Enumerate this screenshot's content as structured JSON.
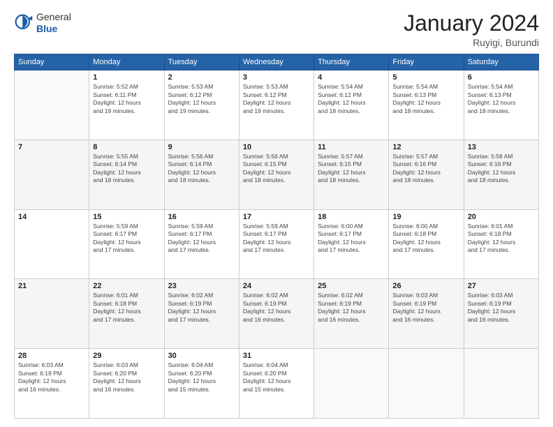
{
  "header": {
    "logo_general": "General",
    "logo_blue": "Blue",
    "title": "January 2024",
    "subtitle": "Ruyigi, Burundi"
  },
  "calendar": {
    "days_of_week": [
      "Sunday",
      "Monday",
      "Tuesday",
      "Wednesday",
      "Thursday",
      "Friday",
      "Saturday"
    ],
    "weeks": [
      [
        {
          "day": "",
          "info": ""
        },
        {
          "day": "1",
          "info": "Sunrise: 5:52 AM\nSunset: 6:11 PM\nDaylight: 12 hours\nand 19 minutes."
        },
        {
          "day": "2",
          "info": "Sunrise: 5:53 AM\nSunset: 6:12 PM\nDaylight: 12 hours\nand 19 minutes."
        },
        {
          "day": "3",
          "info": "Sunrise: 5:53 AM\nSunset: 6:12 PM\nDaylight: 12 hours\nand 19 minutes."
        },
        {
          "day": "4",
          "info": "Sunrise: 5:54 AM\nSunset: 6:12 PM\nDaylight: 12 hours\nand 18 minutes."
        },
        {
          "day": "5",
          "info": "Sunrise: 5:54 AM\nSunset: 6:13 PM\nDaylight: 12 hours\nand 18 minutes."
        },
        {
          "day": "6",
          "info": "Sunrise: 5:54 AM\nSunset: 6:13 PM\nDaylight: 12 hours\nand 18 minutes."
        }
      ],
      [
        {
          "day": "7",
          "info": ""
        },
        {
          "day": "8",
          "info": "Sunrise: 5:55 AM\nSunset: 6:14 PM\nDaylight: 12 hours\nand 18 minutes."
        },
        {
          "day": "9",
          "info": "Sunrise: 5:56 AM\nSunset: 6:14 PM\nDaylight: 12 hours\nand 18 minutes."
        },
        {
          "day": "10",
          "info": "Sunrise: 5:56 AM\nSunset: 6:15 PM\nDaylight: 12 hours\nand 18 minutes."
        },
        {
          "day": "11",
          "info": "Sunrise: 5:57 AM\nSunset: 6:15 PM\nDaylight: 12 hours\nand 18 minutes."
        },
        {
          "day": "12",
          "info": "Sunrise: 5:57 AM\nSunset: 6:16 PM\nDaylight: 12 hours\nand 18 minutes."
        },
        {
          "day": "13",
          "info": "Sunrise: 5:58 AM\nSunset: 6:16 PM\nDaylight: 12 hours\nand 18 minutes."
        }
      ],
      [
        {
          "day": "14",
          "info": ""
        },
        {
          "day": "15",
          "info": "Sunrise: 5:59 AM\nSunset: 6:17 PM\nDaylight: 12 hours\nand 17 minutes."
        },
        {
          "day": "16",
          "info": "Sunrise: 5:59 AM\nSunset: 6:17 PM\nDaylight: 12 hours\nand 17 minutes."
        },
        {
          "day": "17",
          "info": "Sunrise: 5:59 AM\nSunset: 6:17 PM\nDaylight: 12 hours\nand 17 minutes."
        },
        {
          "day": "18",
          "info": "Sunrise: 6:00 AM\nSunset: 6:17 PM\nDaylight: 12 hours\nand 17 minutes."
        },
        {
          "day": "19",
          "info": "Sunrise: 6:00 AM\nSunset: 6:18 PM\nDaylight: 12 hours\nand 17 minutes."
        },
        {
          "day": "20",
          "info": "Sunrise: 6:01 AM\nSunset: 6:18 PM\nDaylight: 12 hours\nand 17 minutes."
        }
      ],
      [
        {
          "day": "21",
          "info": ""
        },
        {
          "day": "22",
          "info": "Sunrise: 6:01 AM\nSunset: 6:18 PM\nDaylight: 12 hours\nand 17 minutes."
        },
        {
          "day": "23",
          "info": "Sunrise: 6:02 AM\nSunset: 6:19 PM\nDaylight: 12 hours\nand 17 minutes."
        },
        {
          "day": "24",
          "info": "Sunrise: 6:02 AM\nSunset: 6:19 PM\nDaylight: 12 hours\nand 16 minutes."
        },
        {
          "day": "25",
          "info": "Sunrise: 6:02 AM\nSunset: 6:19 PM\nDaylight: 12 hours\nand 16 minutes."
        },
        {
          "day": "26",
          "info": "Sunrise: 6:03 AM\nSunset: 6:19 PM\nDaylight: 12 hours\nand 16 minutes."
        },
        {
          "day": "27",
          "info": "Sunrise: 6:03 AM\nSunset: 6:19 PM\nDaylight: 12 hours\nand 16 minutes."
        }
      ],
      [
        {
          "day": "28",
          "info": "Sunrise: 6:03 AM\nSunset: 6:19 PM\nDaylight: 12 hours\nand 16 minutes."
        },
        {
          "day": "29",
          "info": "Sunrise: 6:03 AM\nSunset: 6:20 PM\nDaylight: 12 hours\nand 16 minutes."
        },
        {
          "day": "30",
          "info": "Sunrise: 6:04 AM\nSunset: 6:20 PM\nDaylight: 12 hours\nand 15 minutes."
        },
        {
          "day": "31",
          "info": "Sunrise: 6:04 AM\nSunset: 6:20 PM\nDaylight: 12 hours\nand 15 minutes."
        },
        {
          "day": "",
          "info": ""
        },
        {
          "day": "",
          "info": ""
        },
        {
          "day": "",
          "info": ""
        }
      ]
    ]
  }
}
